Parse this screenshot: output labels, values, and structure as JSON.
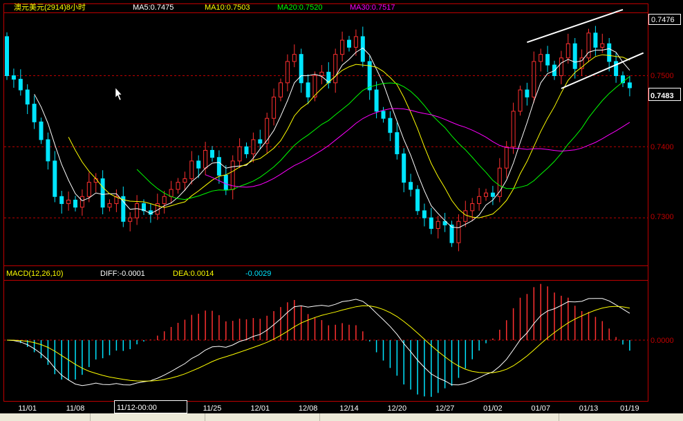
{
  "header": {
    "symbol": "澳元美元(2914)8小时",
    "ma5": "MA5:0.7475",
    "ma10": "MA10:0.7503",
    "ma20": "MA20:0.7520",
    "ma30": "MA30:0.7517"
  },
  "macd_header": {
    "name": "MACD(12,26,10)",
    "diff": "DIFF:-0.0001",
    "dea": "DEA:0.0014",
    "macd": "-0.0029"
  },
  "price_axis": {
    "labels": [
      "0.7500",
      "0.7400",
      "0.7300"
    ],
    "high_box": "0.7476",
    "last_box": "0.7483"
  },
  "macd_axis": {
    "zero_label": "0.0000"
  },
  "cursor_time": "11/12-00:00",
  "colors": {
    "up": "#ff3030",
    "down": "#00e5ff",
    "ma5": "#ffffff",
    "ma10": "#ffff00",
    "ma20": "#00ff00",
    "ma30": "#ff00ff",
    "diff": "#ffffff",
    "dea": "#ffff00",
    "frame": "#c00000",
    "grid": "#c00000"
  },
  "chart_data": [
    {
      "type": "candlestick",
      "title": "澳元美元(2914)8小时",
      "ylim": [
        0.7233,
        0.7589
      ],
      "y_ticks": [
        0.73,
        0.74,
        0.75
      ],
      "grid": "dashed horizontal at ticks",
      "x_ticks": [
        {
          "label": "11/01",
          "index": 3
        },
        {
          "label": "11/08",
          "index": 10
        },
        {
          "label": "1",
          "index": 16
        },
        {
          "label": "11/25",
          "index": 30
        },
        {
          "label": "12/01",
          "index": 37
        },
        {
          "label": "12/08",
          "index": 44
        },
        {
          "label": "12/14",
          "index": 50
        },
        {
          "label": "12/20",
          "index": 57
        },
        {
          "label": "12/27",
          "index": 64
        },
        {
          "label": "01/02",
          "index": 71
        },
        {
          "label": "01/07",
          "index": 78
        },
        {
          "label": "01/13",
          "index": 85
        },
        {
          "label": "01/19",
          "index": 91
        }
      ],
      "close": [
        0.75,
        0.7495,
        0.748,
        0.746,
        0.7435,
        0.741,
        0.738,
        0.733,
        0.732,
        0.7325,
        0.7315,
        0.733,
        0.735,
        0.7355,
        0.7315,
        0.732,
        0.733,
        0.7295,
        0.73,
        0.732,
        0.731,
        0.7305,
        0.732,
        0.733,
        0.734,
        0.735,
        0.7355,
        0.738,
        0.737,
        0.7395,
        0.7385,
        0.736,
        0.734,
        0.738,
        0.74,
        0.739,
        0.741,
        0.7405,
        0.744,
        0.747,
        0.749,
        0.752,
        0.753,
        0.749,
        0.747,
        0.75,
        0.7505,
        0.749,
        0.753,
        0.755,
        0.754,
        0.7555,
        0.752,
        0.748,
        0.745,
        0.744,
        0.742,
        0.739,
        0.735,
        0.734,
        0.731,
        0.73,
        0.7285,
        0.7295,
        0.729,
        0.7265,
        0.7295,
        0.731,
        0.732,
        0.733,
        0.7335,
        0.733,
        0.737,
        0.74,
        0.745,
        0.748,
        0.747,
        0.752,
        0.753,
        0.7515,
        0.75,
        0.7525,
        0.7545,
        0.751,
        0.7525,
        0.756,
        0.754,
        0.7545,
        0.752,
        0.75,
        0.749,
        0.7483
      ],
      "first_open": 0.7555,
      "series_names": [
        "MA5",
        "MA10",
        "MA20",
        "MA30"
      ],
      "trendlines": [
        {
          "from": {
            "index": 76,
            "price": 0.7547
          },
          "to": {
            "index": 90,
            "price": 0.7593
          }
        },
        {
          "from": {
            "index": 81,
            "price": 0.7482
          },
          "to": {
            "index": 93,
            "price": 0.7532
          }
        }
      ]
    },
    {
      "type": "macd",
      "params": [
        12,
        26,
        10
      ],
      "series": [
        {
          "name": "DIFF"
        },
        {
          "name": "DEA"
        },
        {
          "name": "MACD"
        }
      ]
    }
  ]
}
